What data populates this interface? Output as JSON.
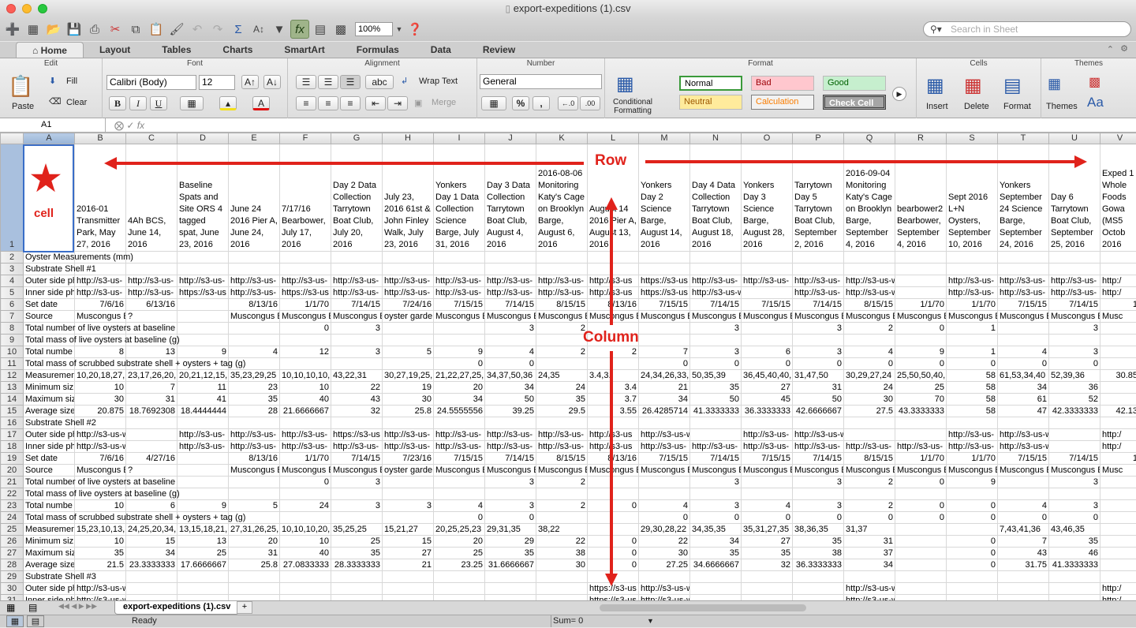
{
  "window": {
    "title": "export-expeditions (1).csv"
  },
  "toolbar": {
    "zoom": "100%",
    "search_placeholder": "Search in Sheet"
  },
  "ribbon_tabs": [
    "Home",
    "Layout",
    "Tables",
    "Charts",
    "SmartArt",
    "Formulas",
    "Data",
    "Review"
  ],
  "ribbon": {
    "groups": {
      "edit": "Edit",
      "font": "Font",
      "alignment": "Alignment",
      "number": "Number",
      "format": "Format",
      "cells": "Cells",
      "themes": "Themes"
    },
    "paste": "Paste",
    "fill": "Fill",
    "clear": "Clear",
    "font_name": "Calibri (Body)",
    "font_size": "12",
    "bold": "B",
    "italic": "I",
    "underline": "U",
    "wrap_text": "Wrap Text",
    "merge": "Merge",
    "abc": "abc",
    "number_format": "General",
    "conditional_formatting": "Conditional Formatting",
    "styles": {
      "normal": "Normal",
      "bad": "Bad",
      "good": "Good",
      "neutral": "Neutral",
      "calculation": "Calculation",
      "check_cell": "Check Cell"
    },
    "insert": "Insert",
    "delete": "Delete",
    "format": "Format",
    "themes": "Themes",
    "aa": "Aa"
  },
  "formula_bar": {
    "cell_ref": "A1",
    "fx": "fx",
    "content": ""
  },
  "columns": [
    "A",
    "B",
    "C",
    "D",
    "E",
    "F",
    "G",
    "H",
    "I",
    "J",
    "K",
    "L",
    "M",
    "N",
    "O",
    "P",
    "Q",
    "R",
    "S",
    "T",
    "U",
    "V"
  ],
  "header_row": [
    "",
    "2016-01 Transmitter Park, May 27, 2016",
    "4Ah BCS, June 14, 2016",
    "Baseline Spats and Site ORS 4 tagged spat, June 23, 2016",
    "June 24 2016 Pier A, June 24, 2016",
    "7/17/16 Bearbower, July 17, 2016",
    "Day 2 Data Collection Tarrytown Boat Club, July 20, 2016",
    "July 23, 2016 61st & John Finley Walk, July 23, 2016",
    "Yonkers Day 1 Data Collection Science Barge, July 31, 2016",
    "Day 3 Data Collection Tarrytown Boat Club, August 4, 2016",
    "2016-08-06 Monitoring Katy's Cage on Brooklyn Barge, August 6, 2016",
    "August 14 2016 Pier A, August 13, 2016",
    "Yonkers Day 2 Science Barge, August 14, 2016",
    "Day 4 Data Collection Tarrytown Boat Club, August 18, 2016",
    "Yonkers Day 3 Science Barge, August 28, 2016",
    "Tarrytown Day 5 Tarrytown Boat Club, September 2, 2016",
    "2016-09-04 Monitoring Katy's Cage on Brooklyn Barge, September 4, 2016",
    "bearbower2 Bearbower, September 4, 2016",
    "Sept 2016 L+N Oysters, September 10, 2016",
    "Yonkers September 24 Science Barge, September 24, 2016",
    "Day 6 Tarrytown Boat Club, September 25, 2016",
    "Exped 1 Whole Foods Gowa (MS5 Octob 2016"
  ],
  "rows": [
    {
      "n": "2",
      "cells": [
        "Oyster Measurements (mm)"
      ]
    },
    {
      "n": "3",
      "cells": [
        "Substrate Shell #1"
      ]
    },
    {
      "n": "4",
      "cells": [
        "Outer side ph",
        "http://s3-us-",
        "http://s3-us-",
        "http://s3-us-",
        "http://s3-us-",
        "http://s3-us-",
        "http://s3-us-",
        "http://s3-us-",
        "http://s3-us-",
        "http://s3-us-",
        "http://s3-us-",
        "http://s3-us",
        "https://s3-us",
        "http://s3-us-",
        "http://s3-us-",
        "http://s3-us-",
        "http://s3-us-west-1.amazo",
        "",
        "http://s3-us-",
        "http://s3-us-",
        "http://s3-us-",
        "http:/"
      ]
    },
    {
      "n": "5",
      "cells": [
        "Inner side ph",
        "http://s3-us-",
        "http://s3-us-",
        "https://s3-us",
        "http://s3-us-",
        "https://s3-us",
        "http://s3-us-",
        "http://s3-us-",
        "http://s3-us-",
        "http://s3-us-",
        "http://s3-us-",
        "http://s3-us",
        "https://s3-us",
        "http://s3-us-west-1.amazo",
        "",
        "http://s3-us-",
        "http://s3-us-west-1.amazo",
        "",
        "http://s3-us-",
        "http://s3-us-",
        "http://s3-us-",
        "http:/"
      ]
    },
    {
      "n": "6",
      "cells": [
        "Set date",
        "7/6/16",
        "6/13/16",
        "",
        "8/13/16",
        "1/1/70",
        "7/14/15",
        "7/24/16",
        "7/15/15",
        "7/14/15",
        "8/15/15",
        "8/13/16",
        "7/15/15",
        "7/14/15",
        "7/15/15",
        "7/14/15",
        "8/15/15",
        "1/1/70",
        "1/1/70",
        "7/15/15",
        "7/14/15",
        "1"
      ]
    },
    {
      "n": "7",
      "cells": [
        "Source",
        "Muscongus E",
        "?",
        "",
        "Muscongus E",
        "Muscongus E",
        "Muscongus E",
        "oyster garde",
        "Muscongus E",
        "Muscongus E",
        "Muscongus E",
        "Muscongus E",
        "Muscongus E",
        "Muscongus E",
        "Muscongus E",
        "Muscongus E",
        "Muscongus E",
        "Muscongus E",
        "Muscongus E",
        "Muscongus E",
        "Muscongus E",
        "Musc"
      ]
    },
    {
      "n": "8",
      "cells": [
        "Total number of live oysters at baseline",
        "",
        "",
        "",
        "",
        "0",
        "3",
        "",
        "",
        "3",
        "2",
        "",
        "",
        "3",
        "",
        "3",
        "2",
        "0",
        "1",
        "",
        "3",
        ""
      ]
    },
    {
      "n": "9",
      "cells": [
        "Total mass of live oysters at baseline (g)"
      ]
    },
    {
      "n": "10",
      "cells": [
        "Total numbe",
        "8",
        "13",
        "9",
        "4",
        "12",
        "3",
        "5",
        "9",
        "4",
        "2",
        "2",
        "7",
        "3",
        "6",
        "3",
        "4",
        "9",
        "1",
        "4",
        "3",
        ""
      ]
    },
    {
      "n": "11",
      "cells": [
        "Total mass of scrubbed substrate shell + oysters + tag (g)",
        "",
        "",
        "",
        "",
        "",
        "",
        "",
        "0",
        "0",
        "",
        "",
        "0",
        "0",
        "0",
        "0",
        "0",
        "0",
        "0",
        "0",
        "0",
        ""
      ]
    },
    {
      "n": "12",
      "cells": [
        "Measuremen",
        "10,20,18,27,",
        "23,17,26,20,",
        "20,21,12,15,",
        "35,23,29,25",
        "10,10,10,10,",
        "43,22,31",
        "30,27,19,25,",
        "21,22,27,25,",
        "34,37,50,36",
        "24,35",
        "3.4,3.",
        "24,34,26,33,",
        "50,35,39",
        "36,45,40,40,",
        "31,47,50",
        "30,29,27,24",
        "25,50,50,40,",
        "58",
        "61,53,34,40",
        "52,39,36",
        "30.85"
      ]
    },
    {
      "n": "13",
      "cells": [
        "Minimum siz",
        "10",
        "7",
        "11",
        "23",
        "10",
        "22",
        "19",
        "20",
        "34",
        "24",
        "3.4",
        "21",
        "35",
        "27",
        "31",
        "24",
        "25",
        "58",
        "34",
        "36",
        ""
      ]
    },
    {
      "n": "14",
      "cells": [
        "Maximum siz",
        "30",
        "31",
        "41",
        "35",
        "40",
        "43",
        "30",
        "34",
        "50",
        "35",
        "3.7",
        "34",
        "50",
        "45",
        "50",
        "30",
        "70",
        "58",
        "61",
        "52",
        ""
      ]
    },
    {
      "n": "15",
      "cells": [
        "Average size",
        "20.875",
        "18.7692308",
        "18.4444444",
        "28",
        "21.6666667",
        "32",
        "25.8",
        "24.5555556",
        "39.25",
        "29.5",
        "3.55",
        "26.4285714",
        "41.3333333",
        "36.3333333",
        "42.6666667",
        "27.5",
        "43.3333333",
        "58",
        "47",
        "42.3333333",
        "42.13"
      ]
    },
    {
      "n": "16",
      "cells": [
        "Substrate Shell #2"
      ]
    },
    {
      "n": "17",
      "cells": [
        "Outer side ph",
        "http://s3-us-west-1.amazo",
        "",
        "http://s3-us-",
        "http://s3-us-",
        "http://s3-us-",
        "https://s3-us",
        "http://s3-us-",
        "http://s3-us-",
        "http://s3-us-",
        "http://s3-us-",
        "http://s3-us",
        "http://s3-us-west-1.amazo",
        "",
        "http://s3-us-",
        "http://s3-us-west-1.amazonaws.com/d",
        "",
        "",
        "http://s3-us-",
        "http://s3-us-west-1.amazo",
        "",
        "http:/"
      ]
    },
    {
      "n": "18",
      "cells": [
        "Inner side ph",
        "http://s3-us-west-1.amazo",
        "",
        "http://s3-us-",
        "http://s3-us-",
        "http://s3-us-",
        "http://s3-us-",
        "http://s3-us-",
        "http://s3-us-",
        "http://s3-us-",
        "http://s3-us-",
        "http://s3-us",
        "http://s3-us-",
        "http://s3-us-",
        "http://s3-us-",
        "http://s3-us-",
        "http://s3-us-",
        "http://s3-us-",
        "http://s3-us-",
        "http://s3-us-west-1.amazo",
        "",
        "http:/"
      ]
    },
    {
      "n": "19",
      "cells": [
        "Set date",
        "7/6/16",
        "4/27/16",
        "",
        "8/13/16",
        "1/1/70",
        "7/14/15",
        "7/23/16",
        "7/15/15",
        "7/14/15",
        "8/15/15",
        "8/13/16",
        "7/15/15",
        "7/14/15",
        "7/15/15",
        "7/14/15",
        "8/15/15",
        "1/1/70",
        "1/1/70",
        "7/15/15",
        "7/14/15",
        "1"
      ]
    },
    {
      "n": "20",
      "cells": [
        "Source",
        "Muscongus E",
        "?",
        "",
        "Muscongus E",
        "Muscongus E",
        "Muscongus E",
        "oyster garde",
        "Muscongus E",
        "Muscongus E",
        "Muscongus E",
        "Muscongus E",
        "Muscongus E",
        "Muscongus E",
        "Muscongus E",
        "Muscongus E",
        "Muscongus E",
        "Muscongus E",
        "Muscongus E",
        "Muscongus E",
        "Muscongus E",
        "Musc"
      ]
    },
    {
      "n": "21",
      "cells": [
        "Total number of live oysters at baseline",
        "",
        "",
        "",
        "",
        "0",
        "3",
        "",
        "",
        "3",
        "2",
        "",
        "",
        "3",
        "",
        "3",
        "2",
        "0",
        "9",
        "",
        "3",
        ""
      ]
    },
    {
      "n": "22",
      "cells": [
        "Total mass of live oysters at baseline (g)"
      ]
    },
    {
      "n": "23",
      "cells": [
        "Total numbe",
        "10",
        "6",
        "9",
        "5",
        "24",
        "3",
        "3",
        "4",
        "3",
        "2",
        "0",
        "4",
        "3",
        "4",
        "3",
        "2",
        "0",
        "0",
        "4",
        "3",
        ""
      ]
    },
    {
      "n": "24",
      "cells": [
        "Total mass of scrubbed substrate shell + oysters + tag (g)",
        "",
        "",
        "",
        "",
        "",
        "",
        "",
        "0",
        "0",
        "",
        "",
        "0",
        "0",
        "0",
        "0",
        "0",
        "0",
        "0",
        "0",
        "0",
        ""
      ]
    },
    {
      "n": "25",
      "cells": [
        "Measuremen",
        "15,23,10,13,",
        "24,25,20,34,",
        "13,15,18,21,",
        "27,31,26,25,",
        "10,10,10,20,",
        "35,25,25",
        "15,21,27",
        "20,25,25,23",
        "29,31,35",
        "38,22",
        "",
        "29,30,28,22",
        "34,35,35",
        "35,31,27,35",
        "38,36,35",
        "31,37",
        "",
        "",
        "7,43,41,36",
        "43,46,35",
        ""
      ]
    },
    {
      "n": "26",
      "cells": [
        "Minimum siz",
        "10",
        "15",
        "13",
        "20",
        "10",
        "25",
        "15",
        "20",
        "29",
        "22",
        "0",
        "22",
        "34",
        "27",
        "35",
        "31",
        "",
        "0",
        "7",
        "35",
        ""
      ]
    },
    {
      "n": "27",
      "cells": [
        "Maximum siz",
        "35",
        "34",
        "25",
        "31",
        "40",
        "35",
        "27",
        "25",
        "35",
        "38",
        "0",
        "30",
        "35",
        "35",
        "38",
        "37",
        "",
        "0",
        "43",
        "46",
        ""
      ]
    },
    {
      "n": "28",
      "cells": [
        "Average size",
        "21.5",
        "23.3333333",
        "17.6666667",
        "25.8",
        "27.0833333",
        "28.3333333",
        "21",
        "23.25",
        "31.6666667",
        "30",
        "0",
        "27.25",
        "34.6666667",
        "32",
        "36.3333333",
        "34",
        "",
        "0",
        "31.75",
        "41.3333333",
        ""
      ]
    },
    {
      "n": "29",
      "cells": [
        "Substrate Shell #3"
      ]
    },
    {
      "n": "30",
      "cells": [
        "Outer side ph",
        "http://s3-us-west-1.amazonaws.com/d",
        "",
        "",
        "",
        "",
        "",
        "",
        "",
        "",
        "",
        "https://s3-us",
        "http://s3-us-west-1.amazonaws.com/digital-platform",
        "",
        "",
        "",
        "http://s3-us-west-1.amazonaws.com/digital-platform",
        "",
        "",
        "",
        "",
        "http:/"
      ]
    },
    {
      "n": "31",
      "cells": [
        "Inner side ph",
        "http://s3-us-west-1.amazonaws.com/d",
        "",
        "",
        "",
        "",
        "",
        "",
        "",
        "",
        "",
        "https://s3-us",
        "http://s3-us-west-1.amazonaws.com/digital-platform",
        "",
        "",
        "",
        "http://s3-us-west-1.amazonaws.com/digital-platform",
        "",
        "",
        "",
        "",
        "http:/"
      ]
    }
  ],
  "sheet_tab": "export-expeditions (1).csv",
  "status": {
    "ready": "Ready",
    "sum": "Sum= 0"
  },
  "annotations": {
    "row": "Row",
    "column": "Column",
    "cell": "cell"
  },
  "annotation_color": "#e0221b",
  "selection_color": "#3a6ec8"
}
